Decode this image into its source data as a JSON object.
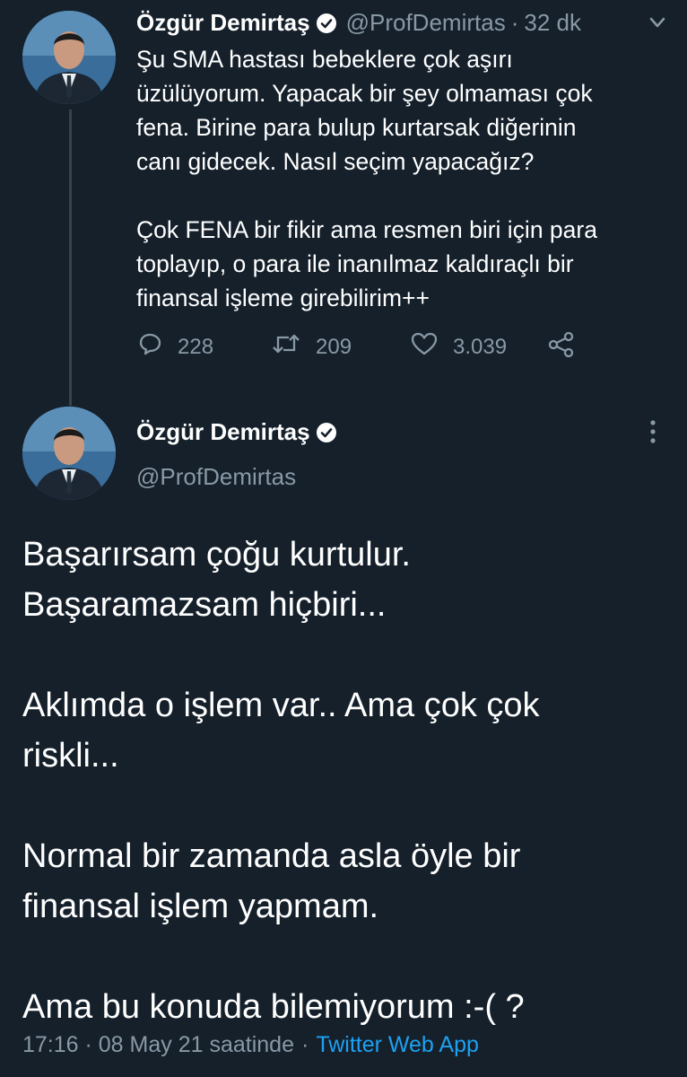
{
  "tweet1": {
    "author_name": "Özgür Demirtaş",
    "handle": "@ProfDemirtas",
    "separator": "·",
    "time_ago": "32 dk",
    "text": "Şu SMA hastası bebeklere çok aşırı\nüzülüyorum. Yapacak bir şey olmaması çok\nfena. Birine para bulup kurtarsak diğerinin\ncanı gidecek. Nasıl seçim yapacağız?\n\nÇok FENA bir fikir ama resmen biri için para\ntoplayıp, o para ile inanılmaz kaldıraçlı bir\nfinansal işleme girebilirim++",
    "replies": "228",
    "retweets": "209",
    "likes": "3.039",
    "icons": [
      "reply-icon",
      "retweet-icon",
      "like-icon",
      "share-icon",
      "chevron-down-icon",
      "verified-badge-icon"
    ]
  },
  "tweet2": {
    "author_name": "Özgür Demirtaş",
    "handle": "@ProfDemirtas",
    "text": "Başarırsam çoğu kurtulur.\nBaşaramazsam hiçbiri...\n\nAklımda o işlem var.. Ama çok çok\nriskli...\n\nNormal bir zamanda asla öyle bir\nfinansal işlem yapmam.\n\nAma bu konuda bilemiyorum :-( ?",
    "timestamp": "17:16 · 08 May 21 saatinde",
    "separator": "·",
    "source": "Twitter Web App",
    "icons": [
      "more-options-icon",
      "verified-badge-icon"
    ]
  },
  "colors": {
    "background": "#15202b",
    "text": "#ffffff",
    "muted": "#8899a6",
    "link": "#1da1f2",
    "thread_line": "#38444d"
  }
}
